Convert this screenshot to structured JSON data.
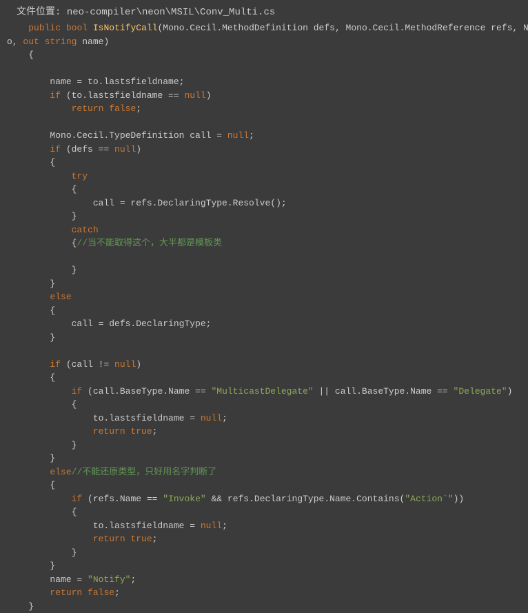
{
  "filePath": {
    "label": "文件位置:",
    "value": "neo-compiler\\neon\\MSIL\\Conv_Multi.cs"
  },
  "code": {
    "tokens": {
      "public": "public",
      "bool": "bool",
      "out": "out",
      "string": "string",
      "if": "if",
      "return": "return",
      "false": "false",
      "true": "true",
      "null": "null",
      "try": "try",
      "catch": "catch",
      "else": "else"
    },
    "funcName": "IsNotifyCall",
    "sig1": "(Mono.Cecil.MethodDefinition defs, Mono.Cecil.MethodReference refs, NeoMethod t",
    "sig2": "o, ",
    "sig3": " name)",
    "line_name_assign": "        name = to.lastsfieldname;",
    "line_if_null": " (to.lastsfieldname == ",
    "line_close_paren": ")",
    "line_return_false": "            ",
    "line_mono_decl": "        Mono.Cecil.TypeDefinition call = ",
    "line_semicolon": ";",
    "line_if_defs": " (defs == ",
    "line_call_refs": "                call = refs.DeclaringType.Resolve();",
    "line_open_brace_comment": "            {",
    "comment1": "//当不能取得这个，大半都是模板类",
    "line_call_defs": "            call = defs.DeclaringType;",
    "line_if_call": " (call != ",
    "line_if_basetype1": " (call.BaseType.Name == ",
    "str_multicast": "\"MulticastDelegate\"",
    "line_if_basetype2": " || call.BaseType.Name == ",
    "str_delegate": "\"Delegate\"",
    "line_lastfield_null": "                to.lastsfieldname = ",
    "line_return_true": "                ",
    "comment2": "//不能还原类型，只好用名字判断了",
    "line_if_refs": " (refs.Name == ",
    "str_invoke": "\"Invoke\"",
    "line_refs_and": " && refs.DeclaringType.Name.Contains(",
    "str_action": "\"Action`\"",
    "line_refs_end": "))",
    "line_name_notify": "        name = ",
    "str_notify": "\"Notify\"",
    "brace_open": "{",
    "brace_close": "}"
  }
}
